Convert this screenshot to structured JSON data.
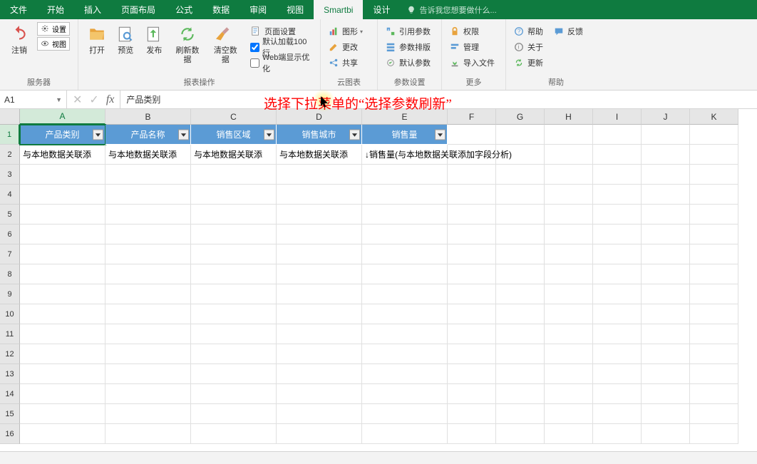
{
  "menu": {
    "tabs": [
      "文件",
      "开始",
      "插入",
      "页面布局",
      "公式",
      "数据",
      "审阅",
      "视图",
      "Smartbi",
      "设计"
    ],
    "active": "Smartbi",
    "tellme": "告诉我您想要做什么..."
  },
  "ribbon": {
    "group_server": {
      "label": "服务器",
      "undo": "注销",
      "settings": "设置",
      "view": "视图"
    },
    "group_report": {
      "label": "报表操作",
      "open": "打开",
      "preview": "预览",
      "publish": "发布",
      "refresh": "刷新数据",
      "clear": "清空数据",
      "page_setup": "页面设置",
      "default_load100": "默认加载100行",
      "web_optimize": "Web端显示优化"
    },
    "group_chart": {
      "label": "云图表",
      "chart": "图形",
      "edit": "更改",
      "share": "共享"
    },
    "group_param": {
      "label": "参数设置",
      "ref_param": "引用参数",
      "param_layout": "参数排版",
      "default_param": "默认参数"
    },
    "group_more": {
      "label": "更多",
      "permission": "权限",
      "manage": "管理",
      "import_file": "导入文件"
    },
    "group_help": {
      "label": "帮助",
      "help": "帮助",
      "feedback": "反馈",
      "about": "关于",
      "update": "更新"
    }
  },
  "formula": {
    "cell_ref": "A1",
    "value": "产品类别"
  },
  "overlay": "选择下拉菜单的“选择参数刷新”",
  "headers_row1": [
    "产品类别",
    "产品名称",
    "销售区域",
    "销售城市",
    "销售量"
  ],
  "row2_cells": [
    "与本地数据关联添",
    "与本地数据关联添",
    "与本地数据关联添",
    "与本地数据关联添",
    "↓销售量(与本地数据关联添加字段分析)"
  ],
  "columns": [
    "A",
    "B",
    "C",
    "D",
    "E",
    "F",
    "G",
    "H",
    "I",
    "J",
    "K"
  ],
  "rows": [
    "1",
    "2",
    "3",
    "4",
    "5",
    "6",
    "7",
    "8",
    "9",
    "10",
    "11",
    "12",
    "13",
    "14",
    "15",
    "16"
  ]
}
